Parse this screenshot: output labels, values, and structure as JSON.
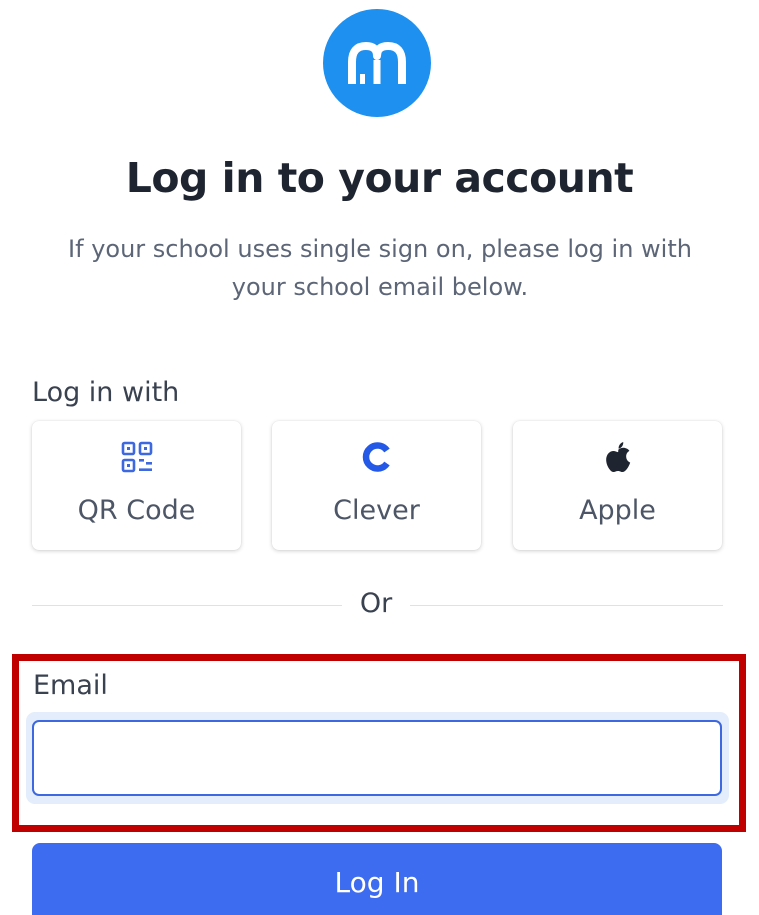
{
  "brand": {
    "logo_icon": "m-logo-icon",
    "logo_color": "#1e90f0"
  },
  "header": {
    "title": "Log in to your account",
    "subtitle": "If your school uses single sign on, please log in with your school email below."
  },
  "login_with": {
    "label": "Log in with",
    "providers": [
      {
        "label": "QR Code",
        "icon": "qr-code-icon"
      },
      {
        "label": "Clever",
        "icon": "clever-c-icon"
      },
      {
        "label": "Apple",
        "icon": "apple-icon"
      }
    ]
  },
  "divider": {
    "label": "Or"
  },
  "email": {
    "label": "Email",
    "value": "",
    "placeholder": ""
  },
  "submit": {
    "label": "Log In"
  },
  "colors": {
    "accent": "#3d6cf0",
    "highlight": "#c00000"
  }
}
